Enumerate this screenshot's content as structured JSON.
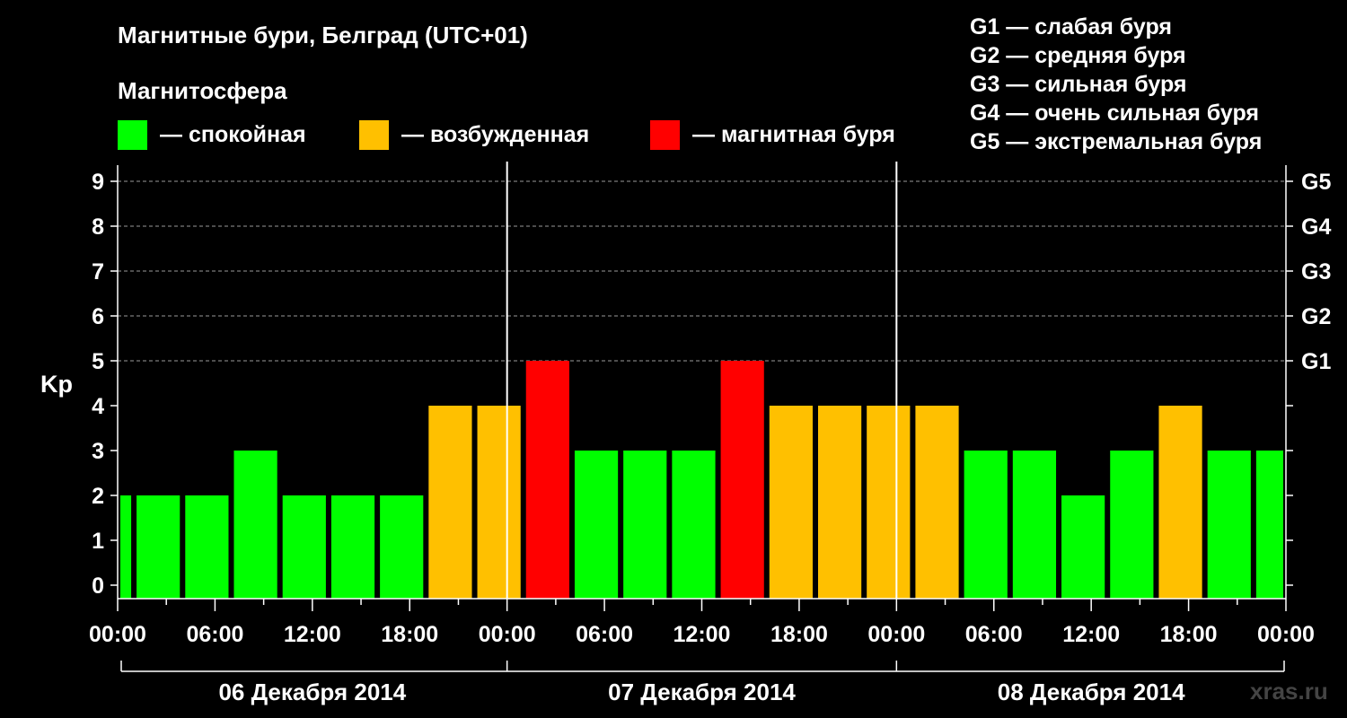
{
  "title": "Магнитные бури, Белград (UTC+01)",
  "subtitle": "Магнитосфера",
  "legend": [
    {
      "label": "— спокойная",
      "color": "#00ff00"
    },
    {
      "label": "— возбужденная",
      "color": "#ffc000"
    },
    {
      "label": "— магнитная буря",
      "color": "#ff0000"
    }
  ],
  "g_levels": [
    "G1 — слабая буря",
    "G2 — средняя буря",
    "G3 — сильная буря",
    "G4 — очень сильная буря",
    "G5 — экстремальная буря"
  ],
  "watermark": "xras.ru",
  "colors": {
    "quiet": "#00ff00",
    "active": "#ffc000",
    "storm": "#ff0000",
    "background": "#000000",
    "axis": "#ffffff"
  },
  "chart_data": {
    "type": "bar",
    "ylabel": "Kp",
    "ylim": [
      0,
      9
    ],
    "y_ticks": [
      "0",
      "1",
      "2",
      "3",
      "4",
      "5",
      "6",
      "7",
      "8",
      "9"
    ],
    "right_ticks": [
      {
        "value": 5,
        "label": "G1"
      },
      {
        "value": 6,
        "label": "G2"
      },
      {
        "value": 7,
        "label": "G3"
      },
      {
        "value": 8,
        "label": "G4"
      },
      {
        "value": 9,
        "label": "G5"
      }
    ],
    "x_range_hours": [
      0,
      72
    ],
    "x_tick_labels": [
      "00:00",
      "06:00",
      "12:00",
      "18:00",
      "00:00",
      "06:00",
      "12:00",
      "18:00",
      "00:00",
      "06:00",
      "12:00",
      "18:00",
      "00:00"
    ],
    "days": [
      "06 Декабря 2014",
      "07 Декабря 2014",
      "08 Декабря 2014"
    ],
    "grid": "dashed horizontal at 5–9",
    "bars": [
      {
        "start_h": 0,
        "end_h": 1,
        "kp": 2,
        "state": "quiet"
      },
      {
        "start_h": 1,
        "end_h": 4,
        "kp": 2,
        "state": "quiet"
      },
      {
        "start_h": 4,
        "end_h": 7,
        "kp": 2,
        "state": "quiet"
      },
      {
        "start_h": 7,
        "end_h": 10,
        "kp": 3,
        "state": "quiet"
      },
      {
        "start_h": 10,
        "end_h": 13,
        "kp": 2,
        "state": "quiet"
      },
      {
        "start_h": 13,
        "end_h": 16,
        "kp": 2,
        "state": "quiet"
      },
      {
        "start_h": 16,
        "end_h": 19,
        "kp": 2,
        "state": "quiet"
      },
      {
        "start_h": 19,
        "end_h": 22,
        "kp": 4,
        "state": "active"
      },
      {
        "start_h": 22,
        "end_h": 25,
        "kp": 4,
        "state": "active"
      },
      {
        "start_h": 25,
        "end_h": 28,
        "kp": 5,
        "state": "storm"
      },
      {
        "start_h": 28,
        "end_h": 31,
        "kp": 3,
        "state": "quiet"
      },
      {
        "start_h": 31,
        "end_h": 34,
        "kp": 3,
        "state": "quiet"
      },
      {
        "start_h": 34,
        "end_h": 37,
        "kp": 3,
        "state": "quiet"
      },
      {
        "start_h": 37,
        "end_h": 40,
        "kp": 5,
        "state": "storm"
      },
      {
        "start_h": 40,
        "end_h": 43,
        "kp": 4,
        "state": "active"
      },
      {
        "start_h": 43,
        "end_h": 46,
        "kp": 4,
        "state": "active"
      },
      {
        "start_h": 46,
        "end_h": 49,
        "kp": 4,
        "state": "active"
      },
      {
        "start_h": 49,
        "end_h": 52,
        "kp": 4,
        "state": "active"
      },
      {
        "start_h": 52,
        "end_h": 55,
        "kp": 3,
        "state": "quiet"
      },
      {
        "start_h": 55,
        "end_h": 58,
        "kp": 3,
        "state": "quiet"
      },
      {
        "start_h": 58,
        "end_h": 61,
        "kp": 2,
        "state": "quiet"
      },
      {
        "start_h": 61,
        "end_h": 64,
        "kp": 3,
        "state": "quiet"
      },
      {
        "start_h": 64,
        "end_h": 67,
        "kp": 4,
        "state": "active"
      },
      {
        "start_h": 67,
        "end_h": 70,
        "kp": 3,
        "state": "quiet"
      },
      {
        "start_h": 70,
        "end_h": 72,
        "kp": 3,
        "state": "quiet"
      }
    ]
  }
}
